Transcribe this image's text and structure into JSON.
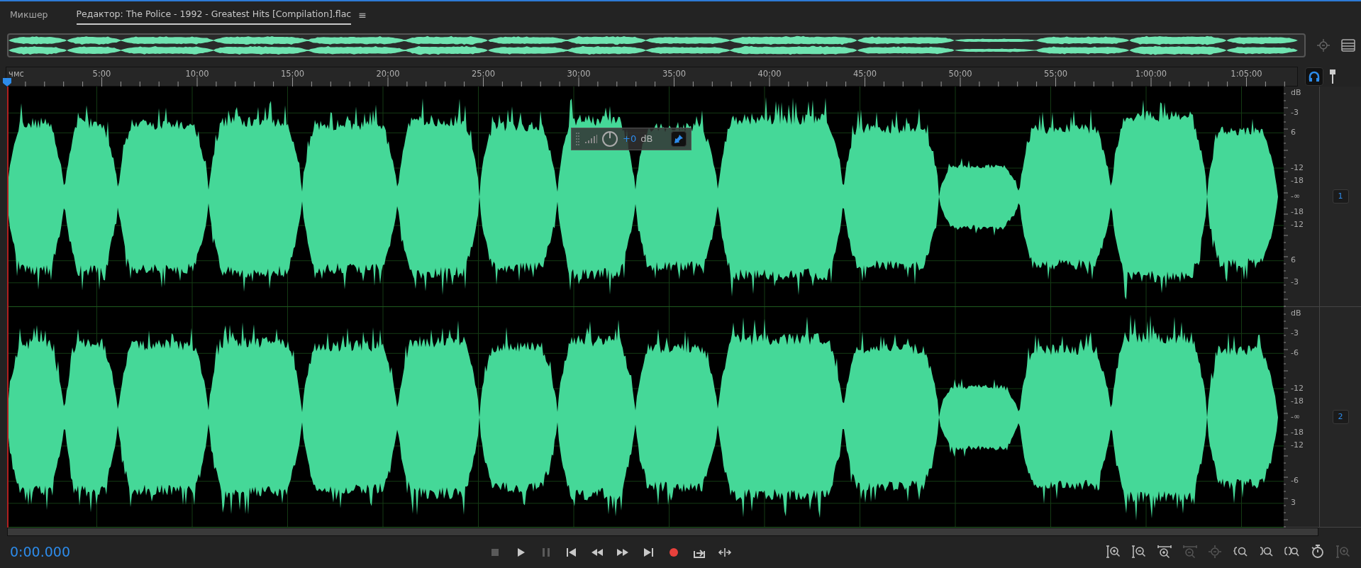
{
  "tabs": [
    {
      "label": "Микшер",
      "selected": false
    },
    {
      "label": "Редактор: The Police - 1992 - Greatest Hits [Compilation].flac",
      "selected": true
    }
  ],
  "tab_menu": "≡",
  "ruler": {
    "unit": "чмс",
    "ticks": [
      "5:00",
      "10:00",
      "15:00",
      "20:00",
      "25:00",
      "30:00",
      "35:00",
      "40:00",
      "45:00",
      "50:00",
      "55:00",
      "1:00:00",
      "1:05:00"
    ]
  },
  "channels": [
    {
      "label": "1",
      "scale": [
        "dB",
        "-3",
        "6",
        "-12",
        "-18",
        "-∞",
        "-18",
        "-12",
        "6",
        "-3"
      ]
    },
    {
      "label": "2",
      "scale": [
        "dB",
        "-3",
        "-6",
        "-12",
        "-18",
        "-∞",
        "-18",
        "-12",
        "-6",
        "3"
      ]
    }
  ],
  "hud": {
    "value": "+0",
    "unit": "dB"
  },
  "time": "0:00.000",
  "transport": [
    {
      "kind": "stop",
      "disabled": true
    },
    {
      "kind": "play",
      "disabled": false
    },
    {
      "kind": "pause",
      "disabled": true
    },
    {
      "kind": "start",
      "disabled": false
    },
    {
      "kind": "rewind",
      "disabled": false
    },
    {
      "kind": "forward",
      "disabled": false
    },
    {
      "kind": "end",
      "disabled": false
    },
    {
      "kind": "record",
      "disabled": false
    },
    {
      "kind": "loop",
      "disabled": false
    },
    {
      "kind": "skip",
      "disabled": false
    }
  ],
  "zoom": [
    {
      "kind": "amp-in",
      "disabled": false
    },
    {
      "kind": "amp-out",
      "disabled": false
    },
    {
      "kind": "time-in",
      "disabled": false
    },
    {
      "kind": "time-out",
      "disabled": true
    },
    {
      "kind": "full",
      "disabled": true
    },
    {
      "kind": "in-left",
      "disabled": false
    },
    {
      "kind": "in-right",
      "disabled": false
    },
    {
      "kind": "selection",
      "disabled": false
    },
    {
      "kind": "timer",
      "disabled": false
    },
    {
      "kind": "amp-reset",
      "disabled": true
    }
  ]
}
